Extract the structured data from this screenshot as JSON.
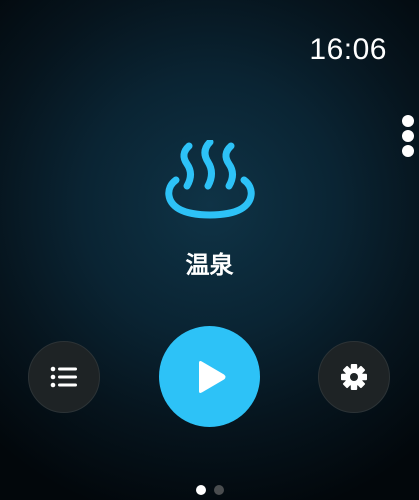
{
  "status_bar": {
    "time": "16:06"
  },
  "more_menu": {
    "icon": "vertical-ellipsis-icon"
  },
  "activity": {
    "icon": "hot-spring-icon",
    "title": "温泉",
    "accent_color": "#2dc2f7"
  },
  "controls": {
    "list_icon": "list-icon",
    "play_icon": "play-icon",
    "settings_icon": "gear-icon"
  },
  "pager": {
    "page_count": 2,
    "current_page": 1
  }
}
